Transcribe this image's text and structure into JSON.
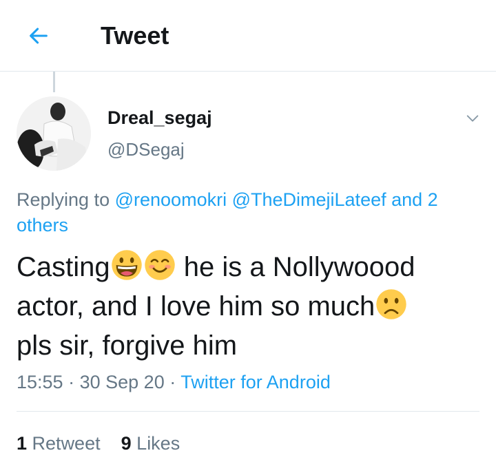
{
  "header": {
    "title": "Tweet",
    "back_icon": "arrow-left-icon"
  },
  "tweet": {
    "author_name": "Dreal_segaj",
    "author_handle": "@DSegaj",
    "replying_prefix": "Replying to",
    "mention_1": "@renoomokri",
    "mention_2": "@TheDimejiLateef",
    "mention_others_a": "and 2",
    "mention_others_b": "others",
    "text_1": "Casting",
    "emoji_1": "grinning-face-emoji",
    "emoji_2": "smiling-face-emoji",
    "text_2": "he is a Nollywoood",
    "text_3": "actor,  and I love him so much",
    "emoji_3": "frowning-face-emoji",
    "text_4": "pls sir,  forgive him",
    "time": "15:55",
    "date": "30 Sep 20",
    "sep": "·",
    "source": "Twitter for Android",
    "retweet_count": "1",
    "retweet_label": "Retweet",
    "like_count": "9",
    "like_label": "Likes"
  },
  "colors": {
    "accent": "#1da1f2",
    "secondary_text": "#657786",
    "primary_text": "#14171a",
    "divider": "#e1e8ed"
  }
}
